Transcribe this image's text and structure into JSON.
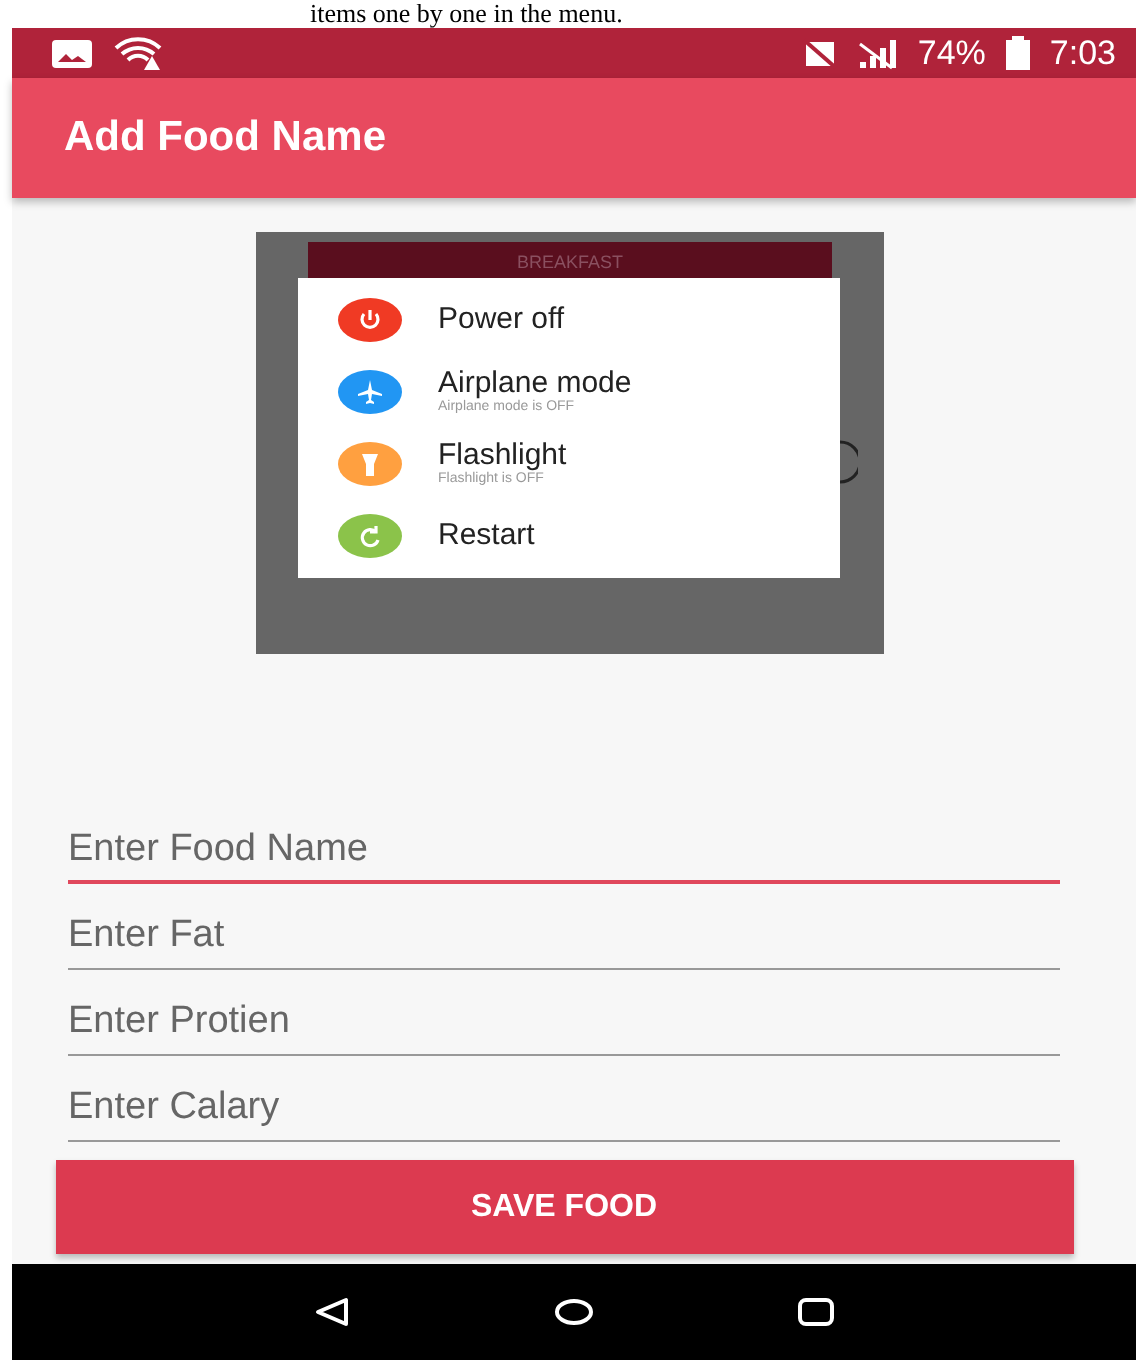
{
  "caption": "items one by one in the menu.",
  "status_bar": {
    "battery": "74%",
    "time": "7:03"
  },
  "app_bar": {
    "title": "Add Food Name"
  },
  "screenshot": {
    "banner": "BREAKFAST",
    "menu": [
      {
        "kind": "power",
        "label": "Power off",
        "color": "#f03a24"
      },
      {
        "kind": "airplane",
        "label": "Airplane mode",
        "subtitle": "Airplane mode is OFF",
        "color": "#2196f3"
      },
      {
        "kind": "flashlight",
        "label": "Flashlight",
        "subtitle": "Flashlight is OFF",
        "color": "#ffa040"
      },
      {
        "kind": "restart",
        "label": "Restart",
        "color": "#8bc34a"
      }
    ]
  },
  "fields": [
    {
      "placeholder": "Enter Food Name",
      "focused": true
    },
    {
      "placeholder": "Enter Fat",
      "focused": false
    },
    {
      "placeholder": "Enter Protien",
      "focused": false
    },
    {
      "placeholder": "Enter Calary",
      "focused": false
    }
  ],
  "button": {
    "label": "SAVE FOOD"
  }
}
